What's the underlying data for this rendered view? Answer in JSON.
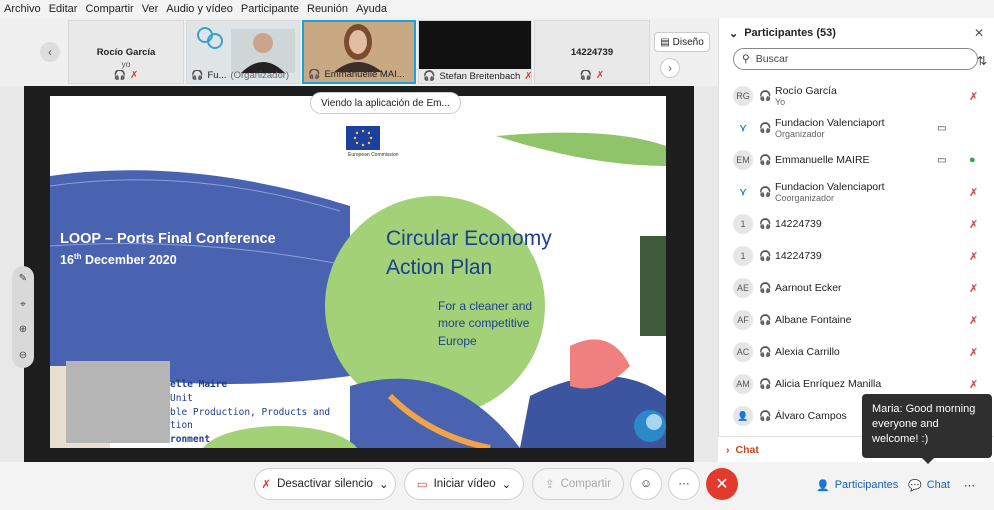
{
  "menu": [
    "Archivo",
    "Editar",
    "Compartir",
    "Ver",
    "Audio y vídeo",
    "Participante",
    "Reunión",
    "Ayuda"
  ],
  "thumbnails": [
    {
      "name": "Rocío García",
      "sub": "yo"
    },
    {
      "name": "Fu...",
      "role": "(Organizador)"
    },
    {
      "name": "Emmanuelle MAI..."
    },
    {
      "name": "Stefan Breitenbach"
    },
    {
      "name": "14224739"
    }
  ],
  "layout_button": "Diseño",
  "viewing_label": "Viendo la aplicación de Em...",
  "slide": {
    "eu_label": "European Commission",
    "conf_title": "LOOP – Ports Final Conference",
    "conf_date_day": "16",
    "conf_date_suffix": "th",
    "conf_date_rest": " December 2020",
    "headline_1": "Circular Economy",
    "headline_2": "Action Plan",
    "sub_1": "For a cleaner and",
    "sub_2": "more competitive",
    "sub_3": "Europe",
    "speaker_1": "elle Maire",
    "speaker_2": "Unit",
    "speaker_3": "ble Production, Products and",
    "speaker_4": "tion",
    "speaker_5": "ronment"
  },
  "panel": {
    "title": "Participantes (53)",
    "search_placeholder": "Buscar",
    "participants": [
      {
        "initials": "RG",
        "name": "Rocío García",
        "role": "Yo",
        "cam": false,
        "mic": "muted"
      },
      {
        "initials": "logo",
        "name": "Fundacion Valenciaport",
        "role": "Organizador",
        "cam": true,
        "mic": "none"
      },
      {
        "initials": "EM",
        "name": "Emmanuelle MAIRE",
        "role": "",
        "cam": true,
        "mic": "on"
      },
      {
        "initials": "logo",
        "name": "Fundacion Valenciaport",
        "role": "Coorganizador",
        "cam": false,
        "mic": "muted"
      },
      {
        "initials": "1",
        "name": "14224739",
        "role": "",
        "cam": false,
        "mic": "muted"
      },
      {
        "initials": "1",
        "name": "14224739",
        "role": "",
        "cam": false,
        "mic": "muted"
      },
      {
        "initials": "AE",
        "name": "Aarnout Ecker",
        "role": "",
        "cam": false,
        "mic": "muted"
      },
      {
        "initials": "AF",
        "name": "Albane Fontaine",
        "role": "",
        "cam": false,
        "mic": "muted"
      },
      {
        "initials": "AC",
        "name": "Alexia Carrillo",
        "role": "",
        "cam": false,
        "mic": "muted"
      },
      {
        "initials": "AM",
        "name": "Alicia Enríquez Manilla",
        "role": "",
        "cam": false,
        "mic": "muted"
      },
      {
        "initials": "",
        "name": "Álvaro Campos",
        "role": "",
        "cam": false,
        "mic": "none"
      }
    ],
    "chat_section": "Chat"
  },
  "tooltip": "Maria: Good morning everyone and welcome! :)",
  "toolbar": {
    "mute": "Desactivar silencio",
    "video": "Iniciar vídeo",
    "share": "Compartir",
    "more": "···",
    "participants": "Participantes",
    "chat": "Chat"
  }
}
